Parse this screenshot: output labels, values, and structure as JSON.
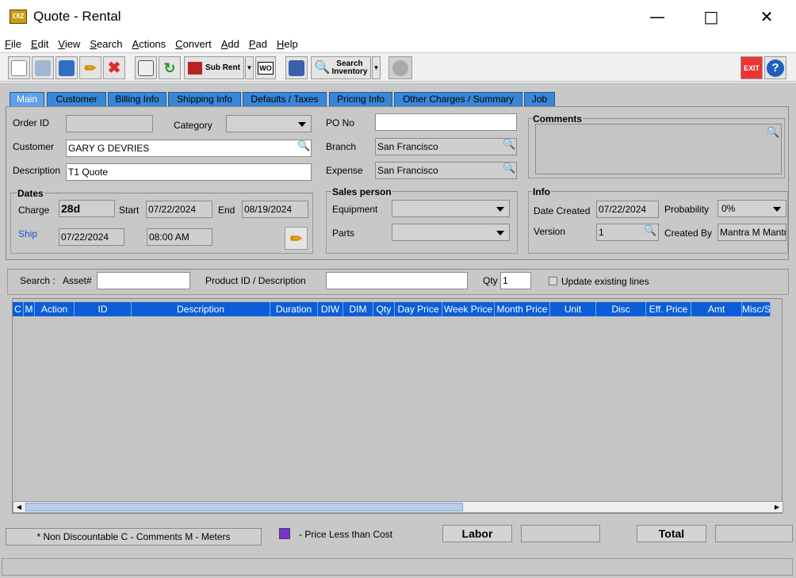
{
  "window": {
    "title": "Quote - Rental",
    "logo": "CRZ"
  },
  "menu": [
    "File",
    "Edit",
    "View",
    "Search",
    "Actions",
    "Convert",
    "Add",
    "Pad",
    "Help"
  ],
  "toolbar": {
    "sub_rent": "Sub Rent",
    "wo": "WO",
    "search_inventory_1": "Search",
    "search_inventory_2": "Inventory",
    "exit": "EXIT",
    "help": "?"
  },
  "tabs": [
    "Main",
    "Customer",
    "Billing Info",
    "Shipping Info",
    "Defaults / Taxes",
    "Pricing Info",
    "Other Charges / Summary",
    "Job"
  ],
  "main": {
    "order_id_label": "Order ID",
    "order_id": "",
    "category_label": "Category",
    "category": "",
    "customer_label": "Customer",
    "customer": "GARY G  DEVRIES",
    "description_label": "Description",
    "description": "T1 Quote",
    "po_label": "PO No",
    "po": "",
    "branch_label": "Branch",
    "branch": "San Francisco",
    "expense_label": "Expense",
    "expense": "San Francisco",
    "comments_label": "Comments"
  },
  "dates": {
    "title": "Dates",
    "charge_label": "Charge",
    "charge": "28d",
    "start_label": "Start",
    "start": "07/22/2024",
    "end_label": "End",
    "end": "08/19/2024",
    "ship_label": "Ship",
    "ship": "07/22/2024",
    "ship_time": "08:00 AM"
  },
  "sales": {
    "title": "Sales person",
    "equipment_label": "Equipment",
    "parts_label": "Parts"
  },
  "info": {
    "title": "Info",
    "date_created_label": "Date Created",
    "date_created": "07/22/2024",
    "probability_label": "Probability",
    "probability": "0%",
    "version_label": "Version",
    "version": "1",
    "created_by_label": "Created By",
    "created_by": "Mantra M Mantra"
  },
  "search": {
    "label": "Search :",
    "asset_label": "Asset#",
    "product_label": "Product ID / Description",
    "qty_label": "Qty",
    "qty": "1",
    "update_label": "Update existing lines"
  },
  "grid_columns": [
    "C",
    "M",
    "Action",
    "ID",
    "Description",
    "Duration",
    "DIW",
    "DIM",
    "Qty",
    "Day Price",
    "Week Price",
    "Month Price",
    "Unit",
    "Disc",
    "Eff. Price",
    "Amt",
    "Misc/S"
  ],
  "status": {
    "legend": "* Non Discountable   C - Comments    M - Meters",
    "price_less": "- Price Less than Cost",
    "labor": "Labor",
    "total": "Total",
    "price_color": "#7b2fd6"
  }
}
